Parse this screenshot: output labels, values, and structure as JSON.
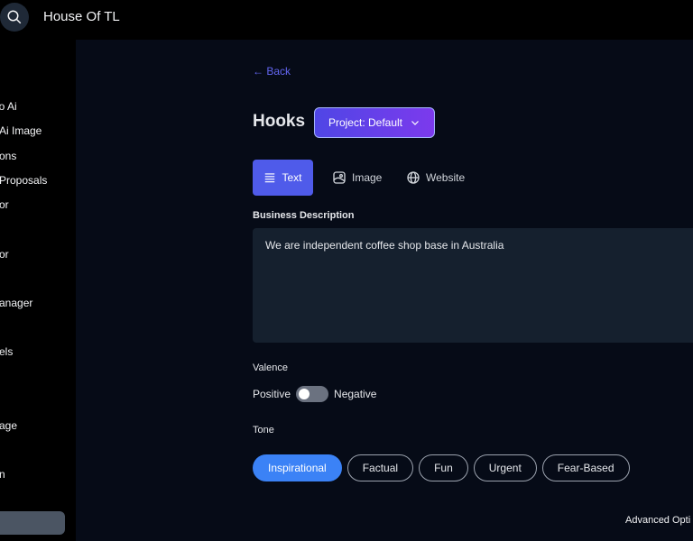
{
  "header": {
    "title": "House Of TL",
    "search_icon": "search-icon"
  },
  "sidebar": {
    "items": [
      {
        "label": "eo Ai"
      },
      {
        "label": "Ai Image"
      },
      {
        "label": "ons"
      },
      {
        "label": "Proposals"
      },
      {
        "label": "or"
      },
      {
        "label": "or"
      },
      {
        "label": "anager"
      },
      {
        "label": "els"
      },
      {
        "label": "age"
      },
      {
        "label": "n"
      }
    ]
  },
  "main": {
    "back_label": "← Back",
    "title": "Hooks",
    "project_button": "Project: Default",
    "tabs": [
      {
        "label": "Text",
        "icon": "list-icon"
      },
      {
        "label": "Image",
        "icon": "image-icon"
      },
      {
        "label": "Website",
        "icon": "globe-icon"
      }
    ],
    "business_label": "Business Description",
    "business_value": "We are independent coffee shop base in Australia",
    "valence_label": "Valence",
    "valence_positive": "Positive",
    "valence_negative": "Negative",
    "tone_label": "Tone",
    "tones": [
      {
        "label": "Inspirational",
        "active": true
      },
      {
        "label": "Factual"
      },
      {
        "label": "Fun"
      },
      {
        "label": "Urgent"
      },
      {
        "label": "Fear-Based"
      }
    ],
    "advanced_label": "Advanced Opti"
  },
  "colors": {
    "accent": "#4f5bea",
    "tone_active": "#3b82f6",
    "background": "#060b17"
  }
}
